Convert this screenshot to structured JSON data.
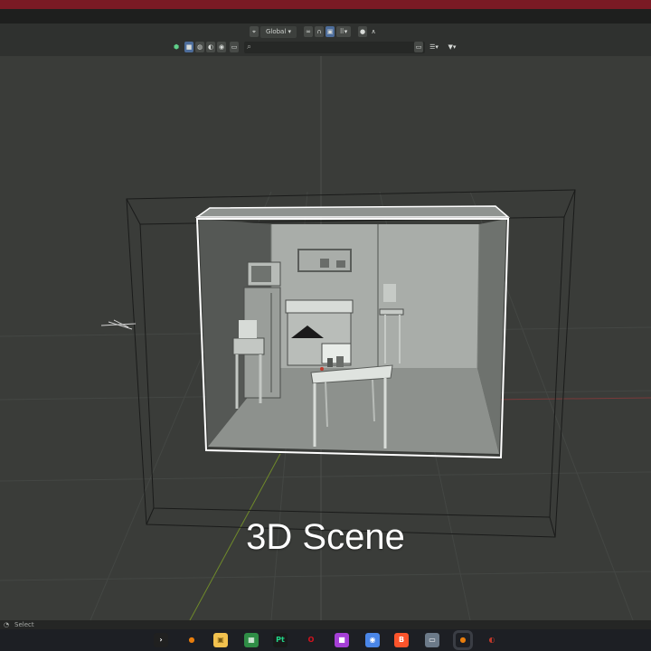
{
  "header": {
    "transform_orientation": "Global",
    "search_placeholder": "",
    "view_icons": [
      "cube-icon",
      "square-icon",
      "sphere-icon",
      "sphere-icon",
      "camera-icon",
      "display-icon"
    ],
    "snap_icons": [
      "link-icon",
      "magnet-icon",
      "grid-icon",
      "proportional-icon"
    ],
    "right_icons": [
      "sort-icon",
      "filter-icon"
    ]
  },
  "viewport": {
    "caption": "3D Scene",
    "wireframe_color": "#ffffff",
    "background_color": "#3a3c39"
  },
  "statusbar": {
    "label": "Select"
  },
  "taskbar": {
    "apps": [
      {
        "name": "terminal",
        "glyph": "›",
        "color": "#202020"
      },
      {
        "name": "blender",
        "glyph": "●",
        "color": "#e87d0d"
      },
      {
        "name": "files",
        "glyph": "▣",
        "color": "#f2c14e"
      },
      {
        "name": "store",
        "glyph": "▦",
        "color": "#2f8d46"
      },
      {
        "name": "pycharm",
        "glyph": "Pt",
        "color": "#21d789"
      },
      {
        "name": "opera",
        "glyph": "O",
        "color": "#d4121e"
      },
      {
        "name": "app-purple",
        "glyph": "■",
        "color": "#a53fd6"
      },
      {
        "name": "chrome",
        "glyph": "◉",
        "color": "#4a86e8"
      },
      {
        "name": "brave",
        "glyph": "B",
        "color": "#fb542b"
      },
      {
        "name": "monitor",
        "glyph": "▭",
        "color": "#6c7a89"
      },
      {
        "name": "blender-2",
        "glyph": "●",
        "color": "#e87d0d"
      },
      {
        "name": "davinci",
        "glyph": "◐",
        "color": "#c0392b"
      }
    ]
  }
}
